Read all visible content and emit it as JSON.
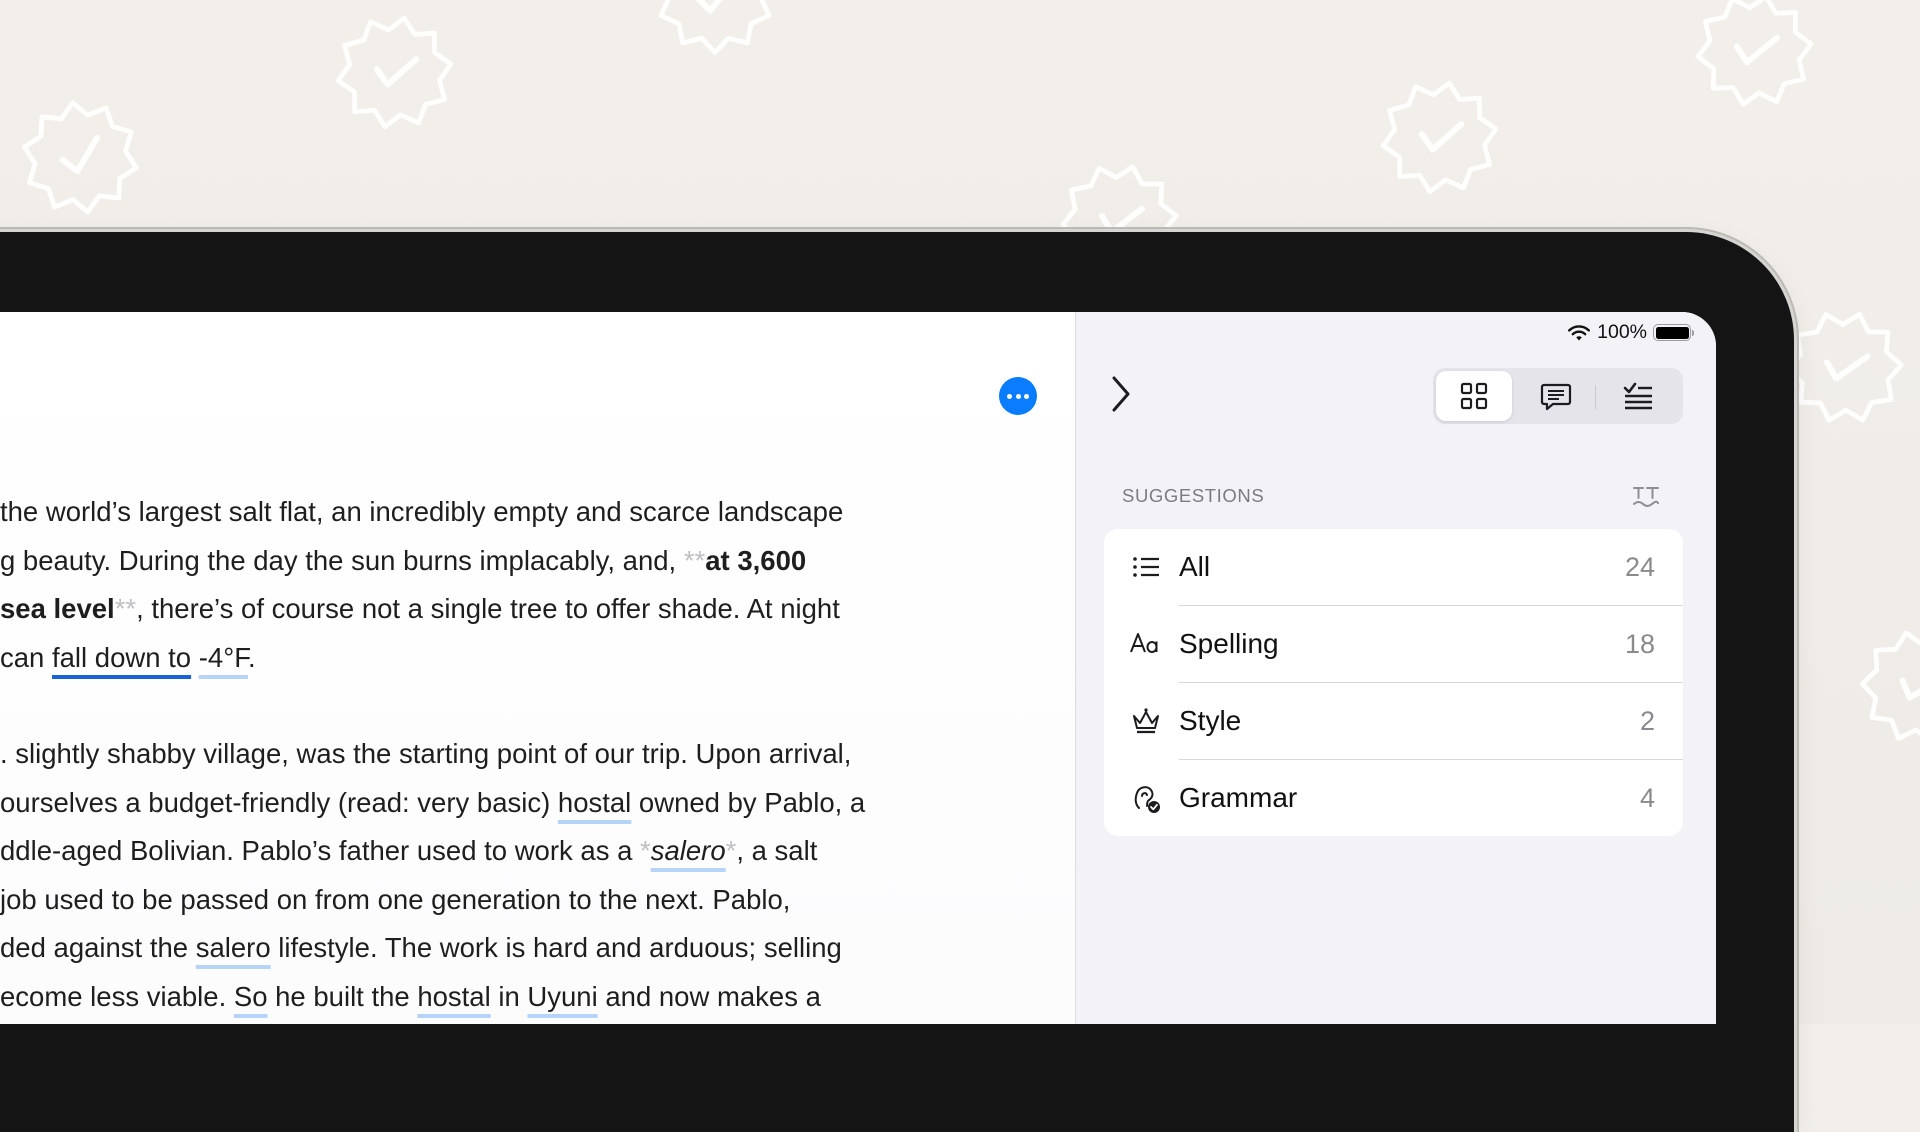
{
  "status_bar": {
    "battery": "100%"
  },
  "sidebar": {
    "section_title": "SUGGESTIONS",
    "view_tabs": [
      {
        "name": "grid-view",
        "icon": "grid-icon",
        "active": true
      },
      {
        "name": "comments-view",
        "icon": "speech-bubble-icon",
        "active": false
      },
      {
        "name": "checklist-view",
        "icon": "checklist-icon",
        "active": false
      }
    ],
    "categories": [
      {
        "label": "All",
        "count": "24",
        "icon": "list-icon"
      },
      {
        "label": "Spelling",
        "count": "18",
        "icon": "text-aa-icon"
      },
      {
        "label": "Style",
        "count": "2",
        "icon": "crown-icon"
      },
      {
        "label": "Grammar",
        "count": "4",
        "icon": "grammar-ear-icon"
      }
    ]
  },
  "document": {
    "p1": {
      "l1": "the world’s largest salt flat, an incredibly empty and scarce landscape",
      "l2a": "g beauty. During the day the sun burns implacably, and, ",
      "md_open": "**",
      "l2b": "at 3,600",
      "l3a": " sea level",
      "md_close": "**",
      "l3b": ", there’s of course not a single tree to offer shade. At night",
      "l4a": "can ",
      "l4b": "fall down to",
      "l4c": " ",
      "l4d": "-4°F",
      "l4e": "."
    },
    "p2": {
      "l1": ". slightly shabby village, was the starting point of our trip. Upon arrival,",
      "l2a": "ourselves a budget-friendly (read: very basic) ",
      "l2b": "hostal",
      "l2c": " owned by Pablo, a",
      "l3a": "ddle-aged Bolivian. Pablo’s father used to work as a ",
      "l3md1": "*",
      "l3b": "salero",
      "l3md2": "*",
      "l3c": ", a salt",
      "l4": "job used to be passed on from one generation to the next. Pablo,",
      "l5a": "ded against the ",
      "l5b": "salero",
      "l5c": " lifestyle. The work is hard and arduous; selling",
      "l6a": "ecome less viable. ",
      "l6b": "So",
      "l6c": " he built the ",
      "l6d": "hostal",
      "l6e": " in ",
      "l6f": "Uyuni",
      "l6g": " and now makes a"
    }
  },
  "colors": {
    "accent": "#0a7cff",
    "underline_primary": "#1a63d6",
    "underline_secondary": "#b5d4f8"
  }
}
